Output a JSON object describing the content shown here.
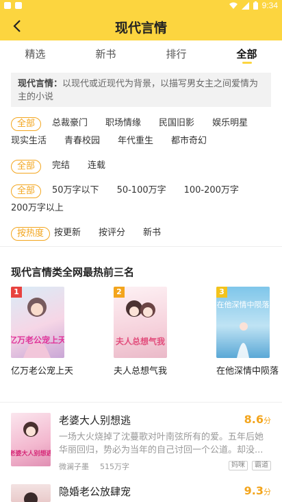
{
  "status_bar": {
    "time": "9:34"
  },
  "header": {
    "title": "现代言情"
  },
  "tabs": [
    "精选",
    "新书",
    "排行",
    "全部"
  ],
  "intro": {
    "label": "现代言情：",
    "text": "以现代或近现代为背景，以描写男女主之间爱情为主的小说"
  },
  "filters": {
    "row1": [
      "全部",
      "总裁豪门",
      "职场情缘",
      "民国旧影",
      "娱乐明星"
    ],
    "row1b": [
      "现实生活",
      "青春校园",
      "年代重生",
      "都市奇幻"
    ],
    "row2": [
      "全部",
      "完结",
      "连载"
    ],
    "row3": [
      "全部",
      "50万字以下",
      "50-100万字",
      "100-200万字"
    ],
    "row3b": [
      "200万字以上"
    ],
    "row4": [
      "按热度",
      "按更新",
      "按评分",
      "新书"
    ]
  },
  "top_section": {
    "title": "现代言情类全网最热前三名",
    "books": [
      {
        "rank": "1",
        "title": "亿万老公宠上天",
        "cover_text": "亿万老公宠上天",
        "rank_color": "#e8423f"
      },
      {
        "rank": "2",
        "title": "夫人总想气我",
        "cover_text": "夫人总想气我",
        "rank_color": "#f3a51d"
      },
      {
        "rank": "3",
        "title": "在他深情中陨落",
        "cover_text": "在他深情中陨落",
        "rank_color": "#f3c31d"
      }
    ]
  },
  "list": [
    {
      "title": "老婆大人别想逃",
      "score": "8.6",
      "score_unit": "分",
      "desc": "一场大火烧掉了沈蔓歌对叶南弦所有的爱。五年后她华丽回归，势必为当年的自己讨回一个公道。却没...",
      "author": "微澜子墨",
      "words": "515万字",
      "tags": [
        "妈咪",
        "霸道"
      ],
      "cover_text": "老婆大人别想逃"
    },
    {
      "title": "隐婚老公放肆宠",
      "score": "9.3",
      "score_unit": "分"
    }
  ]
}
